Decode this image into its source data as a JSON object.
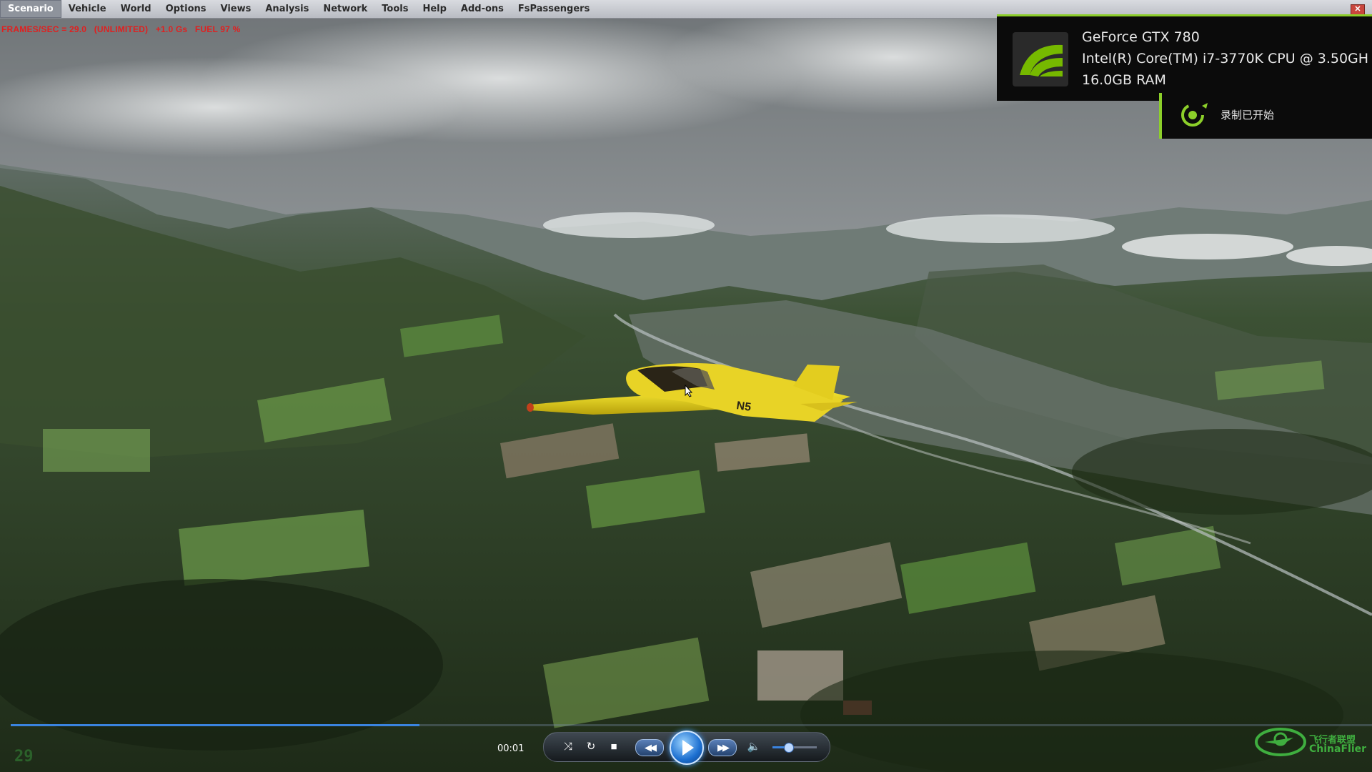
{
  "menubar": {
    "items": [
      "Scenario",
      "Vehicle",
      "World",
      "Options",
      "Views",
      "Analysis",
      "Network",
      "Tools",
      "Help",
      "Add-ons",
      "FsPassengers"
    ],
    "close_glyph": "✕"
  },
  "status": {
    "text": "FRAMES/SEC = 29.0   (UNLIMITED)   +1.0 Gs   FUEL 97 %"
  },
  "gpu_overlay": {
    "gpu": "GeForce GTX 780",
    "cpu": "Intel(R) Core(TM) i7-3770K CPU @ 3.50GH",
    "ram": "16.0GB RAM",
    "recording": "录制已开始",
    "accent": "#8ccf2a"
  },
  "player": {
    "time": "00:01",
    "fps_corner": "29",
    "progress": 0.3,
    "volume": 0.35,
    "accent": "#3a84e0",
    "buttons": [
      "shuffle-icon",
      "repeat-icon",
      "stop-icon",
      "rewind-icon",
      "play-icon",
      "fast-forward-icon",
      "volume-icon"
    ]
  },
  "watermark": {
    "line1": "飞行者联盟",
    "line2": "ChinaFlier"
  },
  "scene": {
    "aircraft_registration": "N5"
  }
}
